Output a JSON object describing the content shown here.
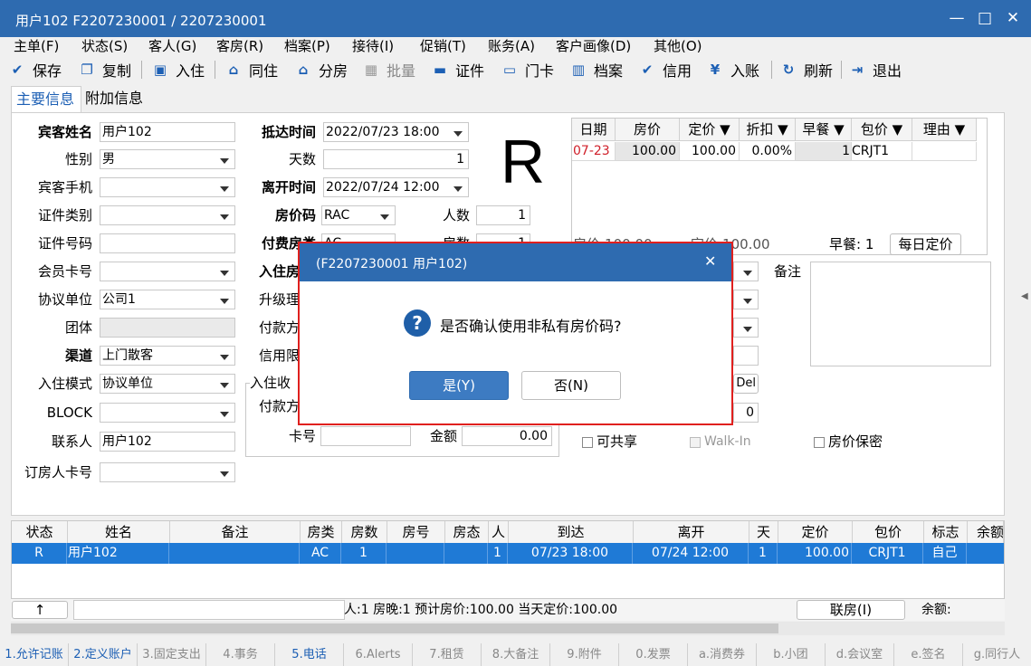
{
  "window": {
    "title": "用户102  F2207230001  /  2207230001",
    "minimize": "—",
    "maximize": "□",
    "close": "✕"
  },
  "menu": [
    "主单(F)",
    "状态(S)",
    "客人(G)",
    "客房(R)",
    "档案(P)",
    "接待(I)",
    "促销(T)",
    "账务(A)",
    "客户画像(D)",
    "其他(O)"
  ],
  "toolbar": {
    "save": "保存",
    "copy": "复制",
    "checkin": "入住",
    "share_room": "同住",
    "assign_room": "分房",
    "batch": "批量",
    "id_card": "证件",
    "room_card": "门卡",
    "profile": "档案",
    "credit": "信用",
    "post": "入账",
    "refresh": "刷新",
    "exit": "退出"
  },
  "tabs": {
    "main": "主要信息",
    "extra": "附加信息"
  },
  "form": {
    "guest_name_label": "宾客姓名",
    "guest_name": "用户102",
    "gender_label": "性别",
    "gender": "男",
    "mobile_label": "宾客手机",
    "mobile": "",
    "id_type_label": "证件类别",
    "id_type": "",
    "id_no_label": "证件号码",
    "id_no": "",
    "member_label": "会员卡号",
    "member": "",
    "company_label": "协议单位",
    "company": "公司1",
    "group_label": "团体",
    "group": "",
    "channel_label": "渠道",
    "channel": "上门散客",
    "mode_label": "入住模式",
    "mode": "协议单位",
    "block_label": "BLOCK",
    "block": "",
    "contact_label": "联系人",
    "contact": "用户102",
    "booker_label": "订房人卡号",
    "booker": "",
    "arrive_label": "抵达时间",
    "arrive": "2022/07/23 18:00",
    "days_label": "天数",
    "days": "1",
    "depart_label": "离开时间",
    "depart": "2022/07/24 12:00",
    "ratecode_label": "房价码",
    "ratecode": "RAC",
    "persons_label": "人数",
    "persons": "1",
    "paytype_label": "付费房类",
    "paytype": "AC",
    "rooms_label": "房数",
    "rooms": "1",
    "checkin_type_label": "入住房",
    "upgrade_label": "升级理",
    "payment_label": "付款方",
    "credit_limit_label": "信用限",
    "deposit_section": "入住收",
    "deposit_pay_label": "付款方",
    "card_no_label": "卡号",
    "card_no": "",
    "amount_label": "金额",
    "amount": "0.00",
    "remark_label": "备注",
    "del_label": "Del",
    "zero_value": "0",
    "shareable": "可共享",
    "walkin": "Walk-In",
    "rate_secret": "房价保密",
    "room_status_big": "R"
  },
  "rategrid": {
    "headers": [
      "日期",
      "房价",
      "定价 ▼",
      "折扣 ▼",
      "早餐 ▼",
      "包价 ▼",
      "理由 ▼"
    ],
    "rows": [
      [
        "07-23",
        "100.00",
        "100.00",
        "0.00%",
        "1",
        "CRJT1",
        ""
      ]
    ],
    "summary_rate": "房价:100.00",
    "summary_fixed": "定价:100.00",
    "summary_bf": "早餐: 1",
    "daily_price_btn": "每日定价"
  },
  "roomgrid": {
    "headers": [
      "状态",
      "姓名",
      "备注",
      "房类",
      "房数",
      "房号",
      "房态",
      "人",
      "到达",
      "离开",
      "天",
      "定价",
      "包价",
      "标志",
      "余额"
    ],
    "rows": [
      [
        "R",
        "用户102",
        "",
        "AC",
        "1",
        "",
        "",
        "1",
        "07/23 18:00",
        "07/24 12:00",
        "1",
        "100.00",
        "CRJT1",
        "自己",
        ""
      ]
    ]
  },
  "statusbar": {
    "up_btn": "↑",
    "text": "人:1  房晚:1  预计房价:100.00  当天定价:100.00",
    "link_btn": "联房(I)",
    "balance": "余额:"
  },
  "fkeys": [
    "1.允许记账",
    "2.定义账户",
    "3.固定支出",
    "4.事务",
    "5.电话",
    "6.Alerts",
    "7.租赁",
    "8.大备注",
    "9.附件",
    "0.发票",
    "a.消费券",
    "b.小团",
    "d.会议室",
    "e.签名",
    "g.同行人"
  ],
  "dialog": {
    "title": "(F2207230001 用户102)",
    "close": "✕",
    "icon": "?",
    "message": "是否确认使用非私有房价码?",
    "yes": "是(Y)",
    "no": "否(N)"
  },
  "colors": {
    "title_bar": "#2e6bb0",
    "selected_row": "#1f7ad6",
    "highlight_border": "#e0201e"
  }
}
